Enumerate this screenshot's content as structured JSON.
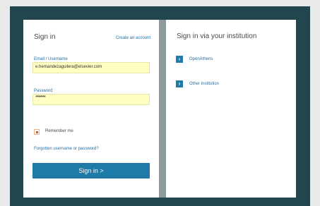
{
  "colors": {
    "background": "#e9eaea",
    "frame": "#23464e",
    "panel_divider": "#8e9a9d",
    "link": "#1d6fa4",
    "button": "#1e7aa6",
    "input_fill": "#ffffc3",
    "checkbox_accent": "#e9502e"
  },
  "left_panel": {
    "title": "Sign in",
    "create_account": "Create an account",
    "email_label": "Email / Username",
    "email_value": "e.hernandezaguilera@elsevier.com",
    "password_label": "Password",
    "password_mask": "********",
    "remember_label": "Remember me",
    "forgot_link": "Forgotten username or password?",
    "signin_button": "Sign in"
  },
  "right_panel": {
    "title": "Sign in via your institution",
    "items": [
      {
        "label": "OpenAthens",
        "icon": "chevron-right-icon"
      },
      {
        "label": "Other institution",
        "icon": "chevron-right-icon"
      }
    ]
  },
  "icons": {
    "signin_button_icon": ">"
  }
}
